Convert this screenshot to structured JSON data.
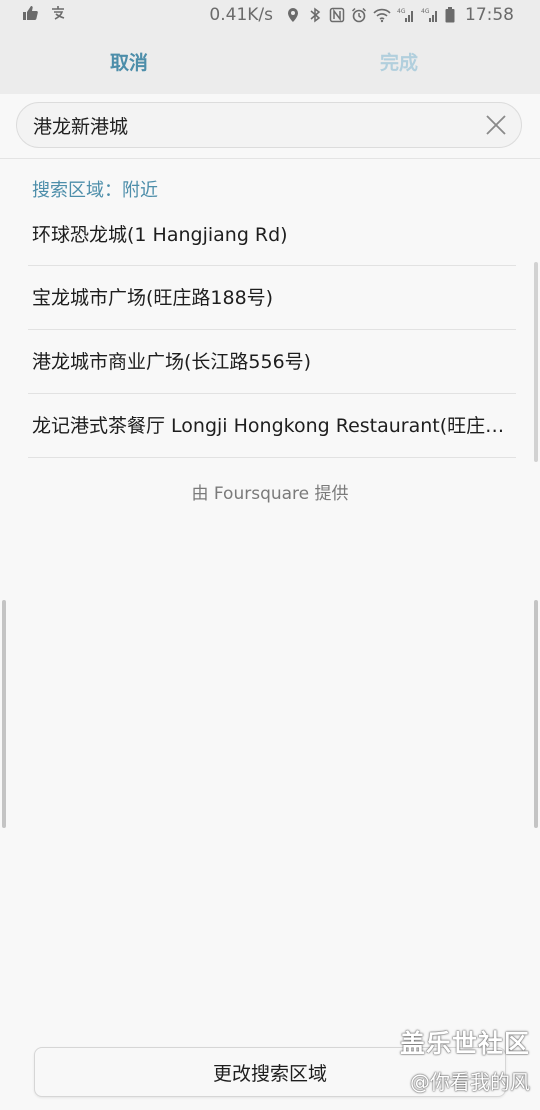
{
  "status_bar": {
    "speed": "0.41K/s",
    "time": "17:58",
    "icons": [
      "thumbs-up-icon",
      "alipay-icon",
      "location-icon",
      "bluetooth-icon",
      "nfc-icon",
      "alarm-icon",
      "wifi-icon",
      "signal-4g-icon",
      "signal-4g-icon",
      "battery-icon"
    ]
  },
  "action_bar": {
    "cancel_label": "取消",
    "done_label": "完成",
    "accent_color": "#4d8eaa",
    "disabled_color": "#b1cfdd"
  },
  "search": {
    "value": "港龙新港城",
    "clear_icon": "close-icon"
  },
  "area_label": "搜索区域：附近",
  "results": [
    "环球恐龙城(1 Hangjiang Rd)",
    "宝龙城市广场(旺庄路188号)",
    "港龙城市商业广场(长江路556号)",
    "龙记港式茶餐厅 Longji Hongkong Restaurant(旺庄路..."
  ],
  "provider_text": "由 Foursquare 提供",
  "change_area_label": "更改搜索区域",
  "watermark": {
    "title": "盖乐世社区",
    "subtitle": "@你看我的风"
  }
}
